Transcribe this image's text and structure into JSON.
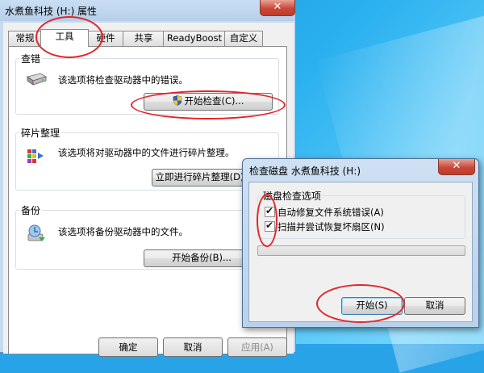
{
  "props_window": {
    "title": "水煮鱼科技 (H:) 属性",
    "close_glyph": "✕"
  },
  "tabs": [
    {
      "label": "常规"
    },
    {
      "label": "工具"
    },
    {
      "label": "硬件"
    },
    {
      "label": "共享"
    },
    {
      "label": "ReadyBoost"
    },
    {
      "label": "自定义"
    }
  ],
  "error_check": {
    "label": "查错",
    "text": "该选项将检查驱动器中的错误。",
    "button": "开始检查(C)..."
  },
  "defrag": {
    "label": "碎片整理",
    "text": "该选项将对驱动器中的文件进行碎片整理。",
    "button": "立即进行碎片整理(D)..."
  },
  "backup": {
    "label": "备份",
    "text": "该选项将备份驱动器中的文件。",
    "button": "开始备份(B)..."
  },
  "footer": {
    "ok": "确定",
    "cancel": "取消",
    "apply": "应用(A)"
  },
  "dialog": {
    "title": "检查磁盘 水煮鱼科技 (H:)",
    "close_glyph": "✕",
    "group_label": "磁盘检查选项",
    "option_fix": {
      "label": "自动修复文件系统错误(A)",
      "checked": true
    },
    "option_scan": {
      "label": "扫描并尝试恢复坏扇区(N)",
      "checked": true
    },
    "progress": 0,
    "start_button": "开始(S)",
    "cancel_button": "取消"
  },
  "colors": {
    "annotation": "#e3262a",
    "close_red": "#c9483a"
  }
}
